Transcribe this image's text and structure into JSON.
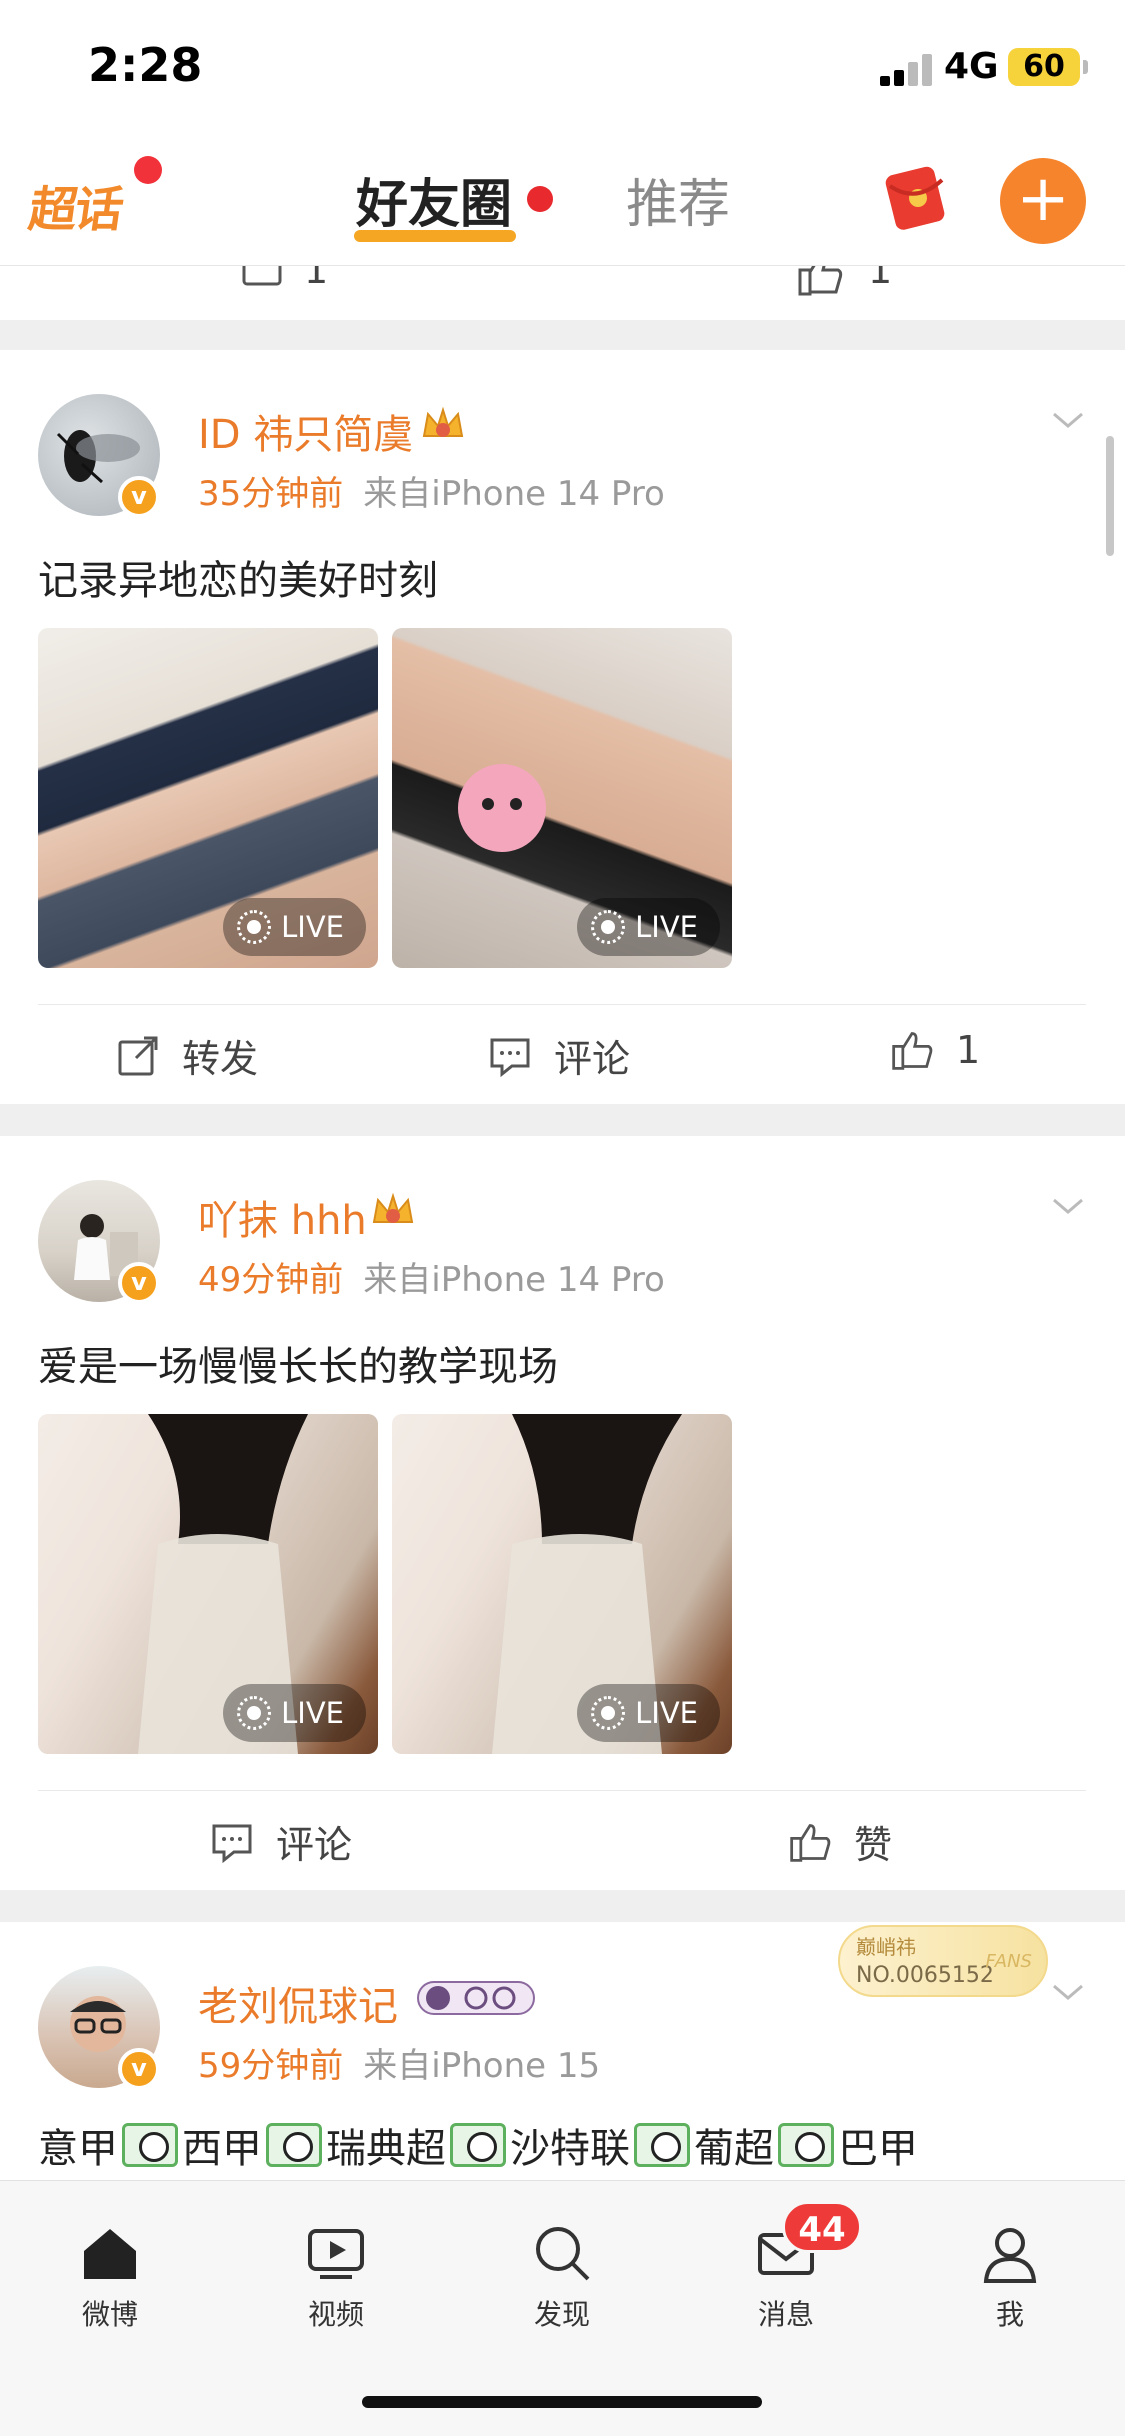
{
  "status_bar": {
    "time": "2:28",
    "network": "4G",
    "battery": "60"
  },
  "top_nav": {
    "chaohua_label": "超话",
    "tabs": [
      {
        "label": "好友圈",
        "active": true
      },
      {
        "label": "推荐",
        "active": false
      }
    ],
    "accent_color": "#f5842c"
  },
  "partial_card": {
    "comment_count": "1",
    "like_count": "1"
  },
  "posts": [
    {
      "username": "ID 祎只简虞",
      "time": "35分钟前",
      "source": "来自iPhone 14 Pro",
      "text": "记录异地恋的美好时刻",
      "images": [
        {
          "badge": "LIVE"
        },
        {
          "badge": "LIVE"
        }
      ],
      "actions": {
        "repost": "转发",
        "comment": "评论",
        "like_count": "1"
      }
    },
    {
      "username": "吖抹 hhh",
      "time": "49分钟前",
      "source": "来自iPhone 14 Pro",
      "text": "爱是一场慢慢长长的教学现场",
      "images": [
        {
          "badge": "LIVE"
        },
        {
          "badge": "LIVE"
        }
      ],
      "actions": {
        "comment": "评论",
        "like": "赞"
      }
    },
    {
      "username": "老刘侃球记",
      "time": "59分钟前",
      "source": "来自iPhone 15",
      "fan_badge": {
        "title": "巅峭祎",
        "number": "NO.0065152",
        "word": "FANS"
      },
      "text_parts": [
        "意甲",
        "西甲",
        "瑞典超",
        "沙特联",
        "葡超",
        "巴甲"
      ]
    }
  ],
  "tabbar": {
    "items": [
      {
        "label": "微博",
        "icon": "home-icon"
      },
      {
        "label": "视频",
        "icon": "video-icon"
      },
      {
        "label": "发现",
        "icon": "search-icon"
      },
      {
        "label": "消息",
        "icon": "mail-icon"
      },
      {
        "label": "我",
        "icon": "user-icon"
      }
    ],
    "message_badge": "44"
  }
}
